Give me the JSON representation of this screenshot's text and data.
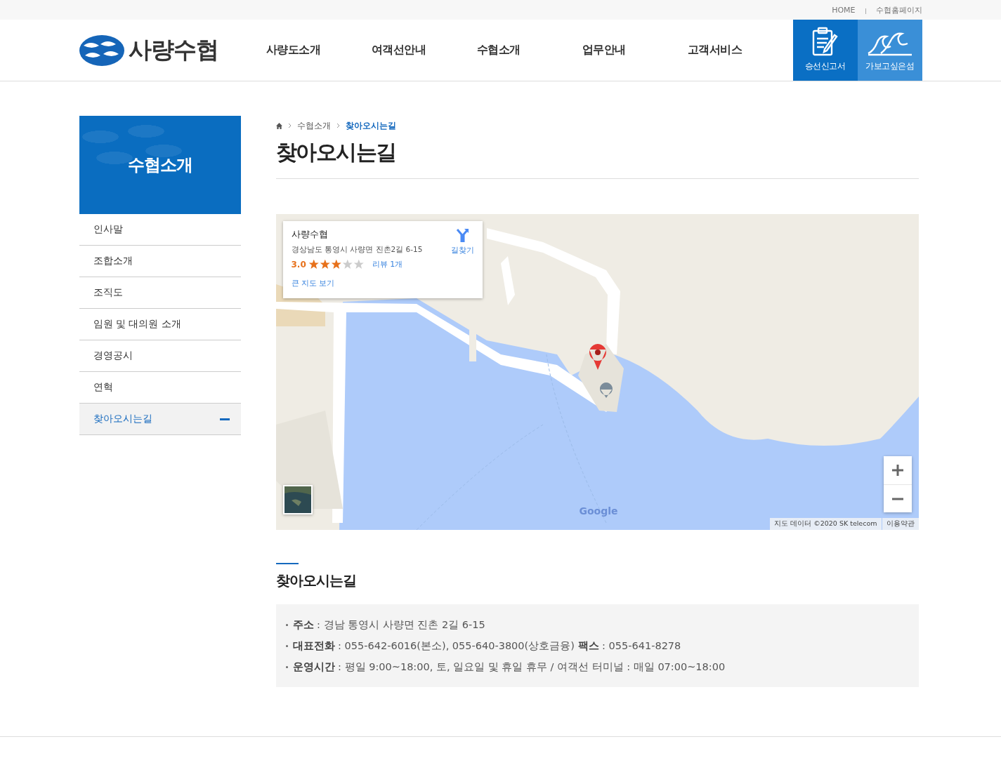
{
  "top_links": [
    {
      "label": "HOME"
    },
    {
      "label": "수협홈페이지"
    }
  ],
  "logo": {
    "text": "사량수협"
  },
  "nav": [
    {
      "label": "사량도소개"
    },
    {
      "label": "여객선안내"
    },
    {
      "label": "수협소개"
    },
    {
      "label": "업무안내"
    },
    {
      "label": "고객서비스"
    }
  ],
  "quick_buttons": [
    {
      "label": "승선신고서",
      "kind": "report"
    },
    {
      "label": "가보고싶은섬",
      "kind": "wave"
    }
  ],
  "sidebar": {
    "title": "수협소개",
    "items": [
      {
        "label": "인사말",
        "selected": false
      },
      {
        "label": "조합소개",
        "selected": false
      },
      {
        "label": "조직도",
        "selected": false
      },
      {
        "label": "임원 및 대의원 소개",
        "selected": false
      },
      {
        "label": "경영공시",
        "selected": false
      },
      {
        "label": "연혁",
        "selected": false
      },
      {
        "label": "찾아오시는길",
        "selected": true
      }
    ]
  },
  "breadcrumb": [
    {
      "label": "수협소개",
      "selected": false
    },
    {
      "label": "찾아오시는길",
      "selected": true
    }
  ],
  "page_title": "찾아오시는길",
  "map": {
    "info_card": {
      "name": "사량수협",
      "address": "경상남도 통영시 사량면 진촌2길 6-15",
      "rating": "3.0",
      "stars": 3,
      "reviews": "리뷰 1개",
      "directions": "길찾기",
      "larger_map": "큰 지도 보기"
    },
    "logo": "Google",
    "attribution": "지도 데이터 ©2020 SK telecom",
    "terms": "이용약관"
  },
  "section_title": "찾아오시는길",
  "info": [
    "**주소** : 경남 통영시 사량면 진촌 2길 6-15",
    "**대표전화** : 055-642-6016(본소), 055-640-3800(상호금융) **팩스** : 055-641-8278",
    "**운영시간** : 평일 9:00~18:00, 토, 일요일 및 휴일 휴무 / 여객선 터미널 : 매일 07:00~18:00"
  ]
}
